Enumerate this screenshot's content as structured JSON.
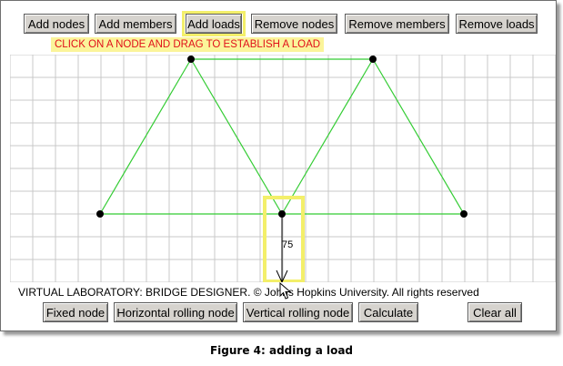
{
  "toolbar_top": {
    "add_nodes": "Add nodes",
    "add_members": "Add members",
    "add_loads": "Add loads",
    "remove_nodes": "Remove nodes",
    "remove_members": "Remove members",
    "remove_loads": "Remove loads"
  },
  "instruction": "CLICK ON A NODE AND DRAG TO ESTABLISH A LOAD",
  "load": {
    "value": "75"
  },
  "footer_text": "VIRTUAL LABORATORY: BRIDGE DESIGNER. © Johns Hopkins University. All rights reserved",
  "toolbar_bottom": {
    "fixed_node": "Fixed node",
    "horizontal_rolling_node": "Horizontal rolling node",
    "vertical_rolling_node": "Vertical rolling node",
    "calculate": "Calculate",
    "clear_all": "Clear all"
  },
  "caption": "Figure 4: adding a load",
  "colors": {
    "member": "#33cc33",
    "highlight": "#f3ef6a",
    "instruction_text": "#e0101a",
    "instruction_bg": "#fbf49a",
    "grid": "#c8c8c8"
  }
}
